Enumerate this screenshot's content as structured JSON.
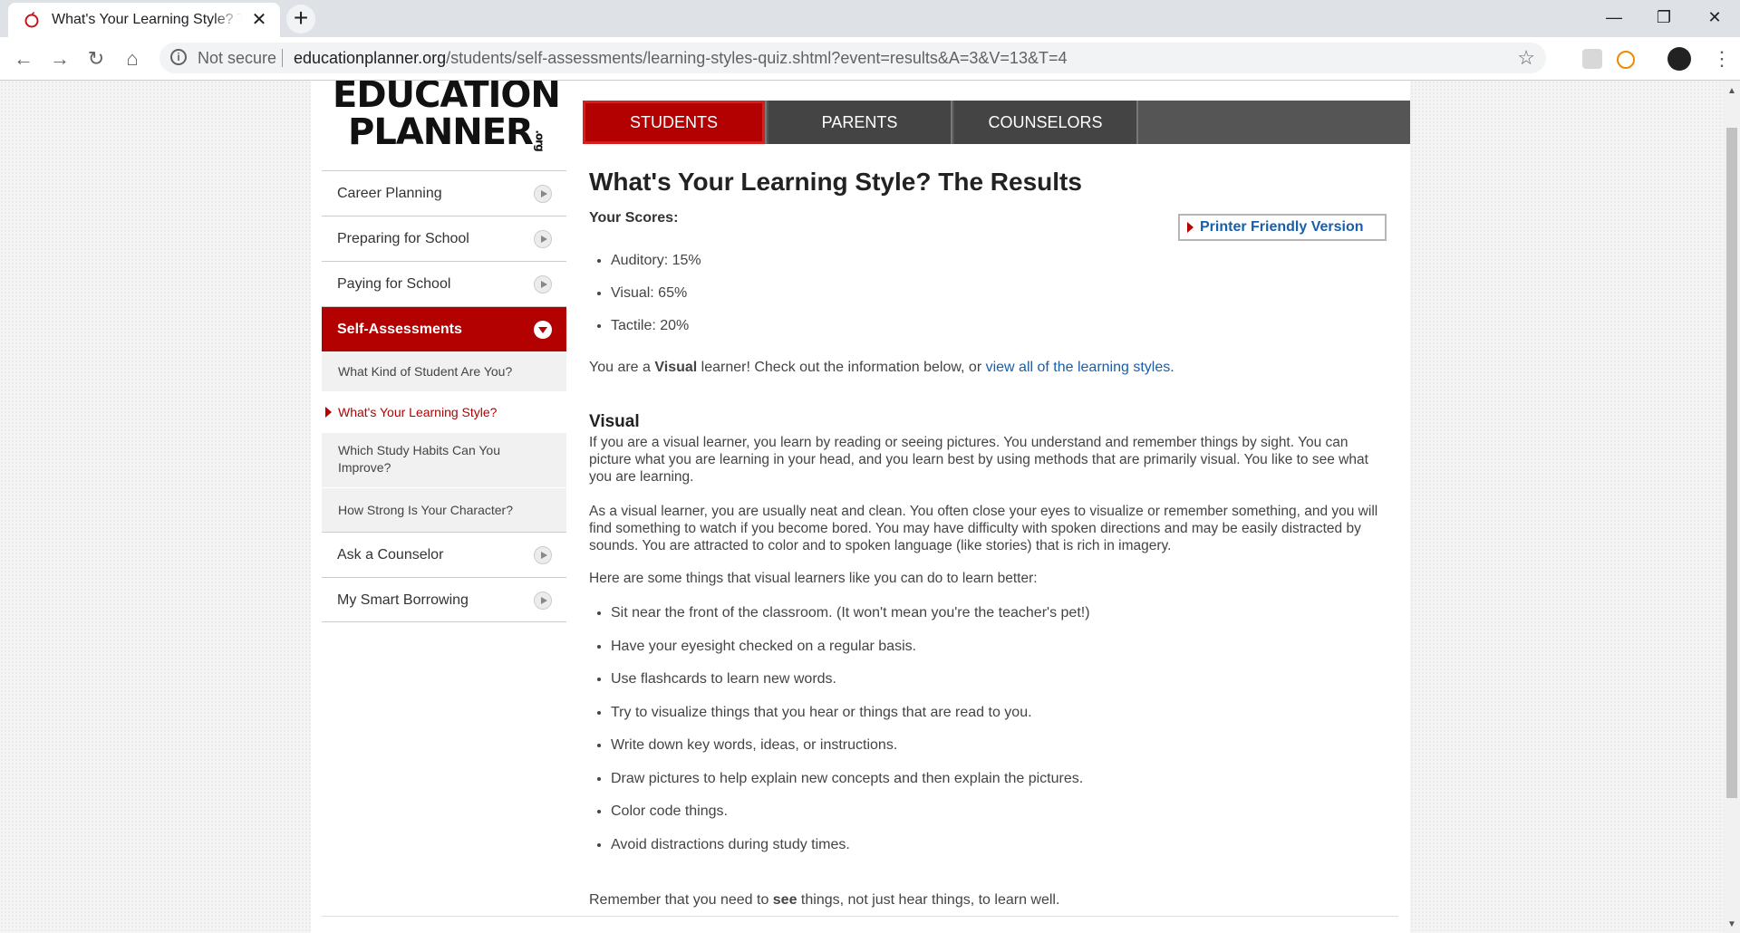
{
  "browser": {
    "tab_title": "What's Your Learning Style? The Results | EducationPlanner.org",
    "new_tab": "+",
    "close": "✕",
    "security_label": "Not secure",
    "url_host": "educationplanner.org",
    "url_path": "/students/self-assessments/learning-styles-quiz.shtml?event=results&A=3&V=13&T=4",
    "window_controls": {
      "minimize": "—",
      "maximize": "❐",
      "close": "✕"
    }
  },
  "logo": {
    "line1": "EDUCATION",
    "line2": "PLANNER",
    "suffix": ".org"
  },
  "topnav": [
    {
      "label": "STUDENTS",
      "active": true
    },
    {
      "label": "PARENTS",
      "active": false
    },
    {
      "label": "COUNSELORS",
      "active": false
    }
  ],
  "sidebar": {
    "items": [
      {
        "label": "Career Planning"
      },
      {
        "label": "Preparing for School"
      },
      {
        "label": "Paying for School"
      },
      {
        "label": "Self-Assessments"
      }
    ],
    "subitems": [
      {
        "label": "What Kind of Student Are You?"
      },
      {
        "label": "What's Your Learning Style?"
      },
      {
        "label": "Which Study Habits Can You Improve?"
      },
      {
        "label": "How Strong Is Your Character?"
      }
    ],
    "bottom_items": [
      {
        "label": "Ask a Counselor"
      },
      {
        "label": "My Smart Borrowing"
      }
    ]
  },
  "main": {
    "title": "What's Your Learning Style? The Results",
    "scores_label": "Your Scores:",
    "printer_link": "Printer Friendly Version",
    "scores": [
      "Auditory: 15%",
      "Visual: 65%",
      "Tactile: 20%"
    ],
    "intro_before": "You are a ",
    "intro_bold": "Visual",
    "intro_mid": " learner! Check out the information below, or ",
    "intro_link": "view all of the learning styles",
    "intro_end": ".",
    "section_heading": "Visual",
    "para1": "If you are a visual learner, you learn by reading or seeing pictures. You understand and remember things by sight. You can picture what you are learning in your head, and you learn best by using methods that are primarily visual. You like to see what you are learning.",
    "para2": "As a visual learner, you are usually neat and clean. You often close your eyes to visualize or remember something, and you will find something to watch if you become bored. You may have difficulty with spoken directions and may be easily distracted by sounds. You are attracted to color and to spoken language (like stories) that is rich in imagery.",
    "para3": "Here are some things that visual learners like you can do to learn better:",
    "tips": [
      "Sit near the front of the classroom. (It won't mean you're the teacher's pet!)",
      "Have your eyesight checked on a regular basis.",
      "Use flashcards to learn new words.",
      "Try to visualize things that you hear or things that are read to you.",
      "Write down key words, ideas, or instructions.",
      "Draw pictures to help explain new concepts and then explain the pictures.",
      "Color code things.",
      "Avoid distractions during study times."
    ],
    "remember_before": "Remember that you need to ",
    "remember_bold": "see",
    "remember_after": " things, not just hear things, to learn well."
  },
  "colors": {
    "brand_red": "#b30000",
    "link_blue": "#1a5ea8",
    "nav_gray": "#444444"
  }
}
